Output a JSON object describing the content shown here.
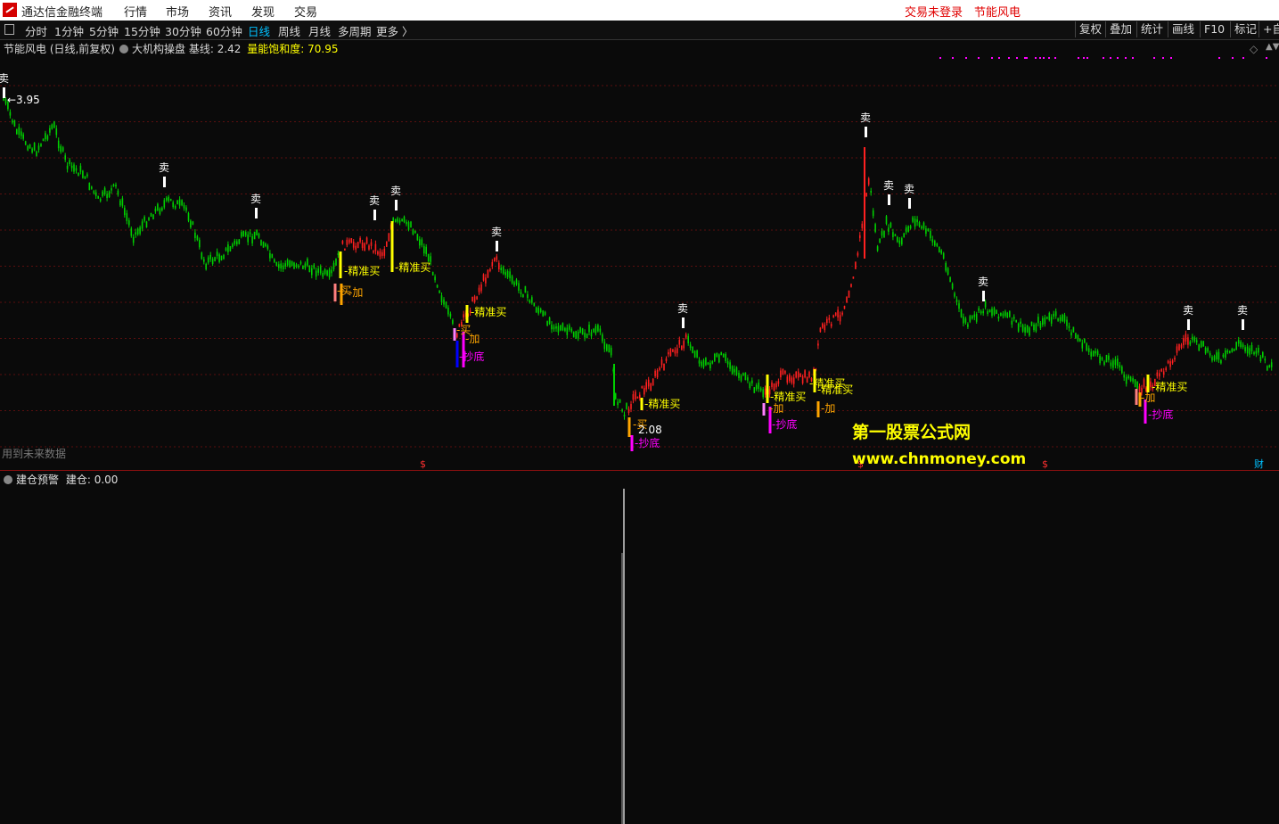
{
  "menubar": {
    "app_title": "通达信金融终端",
    "items": [
      "行情",
      "市场",
      "资讯",
      "发现",
      "交易"
    ],
    "login": "交易未登录",
    "stock": "节能风电"
  },
  "toolbar": {
    "periods": [
      "分时",
      "1分钟",
      "5分钟",
      "15分钟",
      "30分钟",
      "60分钟",
      "日线",
      "周线",
      "月线",
      "多周期",
      "更多 〉"
    ],
    "active": "日线",
    "right_buttons": [
      "复权",
      "叠加",
      "统计",
      "画线",
      "F10",
      "标记",
      "+自"
    ]
  },
  "main_panel": {
    "title": "节能风电 (日线,前复权)",
    "indicator": "大机构操盘",
    "baseline_label": "基线: 2.42",
    "saturation_label": "量能饱和度: 70.95",
    "future_data": "用到未来数据",
    "high_label": "3.95",
    "low_label": "2.08"
  },
  "lower_panel": {
    "title": "建仓预警",
    "value_label": "建仓: 0.00"
  },
  "watermark": {
    "line1": "第一股票公式网",
    "line2": "www.chnmoney.com"
  },
  "markers": {
    "dollar": "$",
    "cai": "财"
  },
  "colors": {
    "up": "#ff2020",
    "down": "#00d000",
    "signal_yellow": "#ffff00",
    "signal_orange": "#ffa500",
    "signal_magenta": "#ff00ff",
    "signal_blue": "#0000ff",
    "grid": "#5a0f0f"
  },
  "chart_data": {
    "type": "candlestick",
    "price_range": [
      2.0,
      4.0
    ],
    "high": 3.95,
    "low": 2.08,
    "sell_points": [
      0,
      73,
      114,
      168,
      178,
      222,
      308,
      388,
      397,
      440,
      535,
      558
    ],
    "buy_signals": [
      {
        "index": 152,
        "labels": [
          "精准买",
          "买",
          "加"
        ]
      },
      {
        "index": 175,
        "labels": [
          "精准买"
        ]
      },
      {
        "index": 206,
        "labels": [
          "精准买",
          "买",
          "加",
          "抄底"
        ]
      },
      {
        "index": 286,
        "labels": [
          "精准买",
          "买",
          "2.08",
          "抄底"
        ]
      },
      {
        "index": 343,
        "labels": [
          "精准买",
          "加",
          "抄底"
        ]
      },
      {
        "index": 365,
        "labels": [
          "精准买",
          "精准买",
          "加"
        ]
      },
      {
        "index": 512,
        "labels": [
          "精准买",
          "加",
          "抄底"
        ]
      }
    ],
    "lower_value": 0.0
  }
}
